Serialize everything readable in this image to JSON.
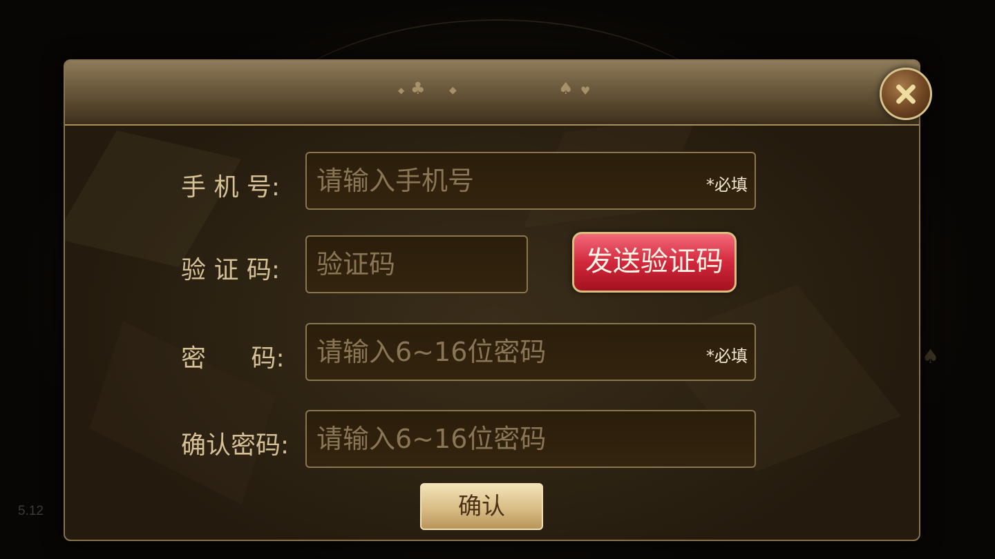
{
  "background": {
    "version_text": "5.12"
  },
  "header": {
    "suits": [
      {
        "name": "diamond",
        "glyph": "◆"
      },
      {
        "name": "club",
        "glyph": "♣"
      },
      {
        "name": "diamond",
        "glyph": "◆"
      },
      {
        "name": "spade",
        "glyph": "♠"
      },
      {
        "name": "heart",
        "glyph": "♥"
      }
    ],
    "close_icon": "close-icon"
  },
  "form": {
    "phone": {
      "label": "手 机 号:",
      "placeholder": "请输入手机号",
      "value": "",
      "required_text": "*必填"
    },
    "code": {
      "label": "验 证 码:",
      "placeholder": "验证码",
      "value": ""
    },
    "send_code_button": "发送验证码",
    "password": {
      "label": "密 码:",
      "placeholder": "请输入6~16位密码",
      "value": "",
      "required_text": "*必填"
    },
    "confirm_password": {
      "label": "确认密码:",
      "placeholder": "请输入6~16位密码",
      "value": ""
    },
    "confirm_button": "确认"
  },
  "colors": {
    "label": "#d6c197",
    "placeholder": "#8a7555",
    "send_button": "#d3283d",
    "confirm_button": "#d8bd85",
    "frame": "#8a7450"
  }
}
